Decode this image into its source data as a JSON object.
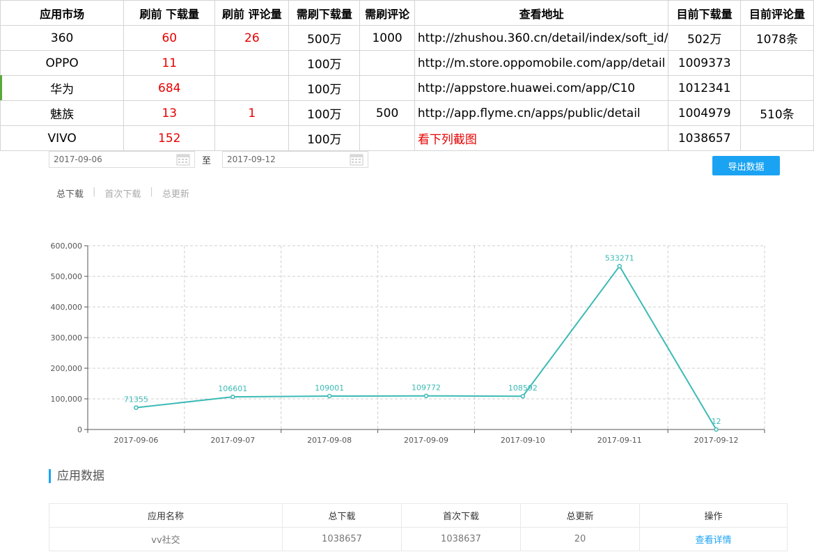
{
  "sheet": {
    "headers": [
      "应用市场",
      "刷前 下载量",
      "刷前 评论量",
      "需刷下载量",
      "需刷评论",
      "查看地址",
      "目前下载量",
      "目前评论量"
    ],
    "rows": [
      {
        "market": "360",
        "pre_dl": "60",
        "pre_cm": "26",
        "need_dl": "500万",
        "need_cm": "1000",
        "url": "http://zhushou.360.cn/detail/index/soft_id/",
        "cur_dl": "502万",
        "cur_cm": "1078条"
      },
      {
        "market": "OPPO",
        "pre_dl": "11",
        "pre_cm": "",
        "need_dl": "100万",
        "need_cm": "",
        "url": "http://m.store.oppomobile.com/app/detail",
        "cur_dl": "1009373",
        "cur_cm": ""
      },
      {
        "market": "华为",
        "pre_dl": "684",
        "pre_cm": "",
        "need_dl": "100万",
        "need_cm": "",
        "url": "http://appstore.huawei.com/app/C10",
        "cur_dl": "1012341",
        "cur_cm": ""
      },
      {
        "market": "魅族",
        "pre_dl": "13",
        "pre_cm": "1",
        "need_dl": "100万",
        "need_cm": "500",
        "url": "http://app.flyme.cn/apps/public/detail",
        "cur_dl": "1004979",
        "cur_cm": "510条"
      },
      {
        "market": "VIVO",
        "pre_dl": "152",
        "pre_cm": "",
        "need_dl": "100万",
        "need_cm": "",
        "url": "看下列截图",
        "cur_dl": "1038657",
        "cur_cm": ""
      }
    ]
  },
  "filter": {
    "start_date": "2017-09-06",
    "to_label": "至",
    "end_date": "2017-09-12",
    "export_label": "导出数据"
  },
  "tabs": [
    "总下载",
    "首次下载",
    "总更新"
  ],
  "chart_data": {
    "type": "line",
    "categories": [
      "2017-09-06",
      "2017-09-07",
      "2017-09-08",
      "2017-09-09",
      "2017-09-10",
      "2017-09-11",
      "2017-09-12"
    ],
    "values": [
      71355,
      106601,
      109001,
      109772,
      108592,
      533271,
      12
    ],
    "yticks": [
      0,
      100000,
      200000,
      300000,
      400000,
      500000,
      600000
    ],
    "ylim": [
      0,
      600000
    ],
    "grid": true,
    "line_color": "#3bbab5"
  },
  "section": {
    "title": "应用数据"
  },
  "app_table": {
    "headers": [
      "应用名称",
      "总下载",
      "首次下载",
      "总更新",
      "操作"
    ],
    "row": {
      "name": "vv社交",
      "total": "1038657",
      "first": "1038637",
      "updates": "20",
      "action": "查看详情"
    }
  },
  "colors": {
    "accent": "#1aa3f3",
    "red": "#e60000",
    "line": "#3bbab5"
  }
}
